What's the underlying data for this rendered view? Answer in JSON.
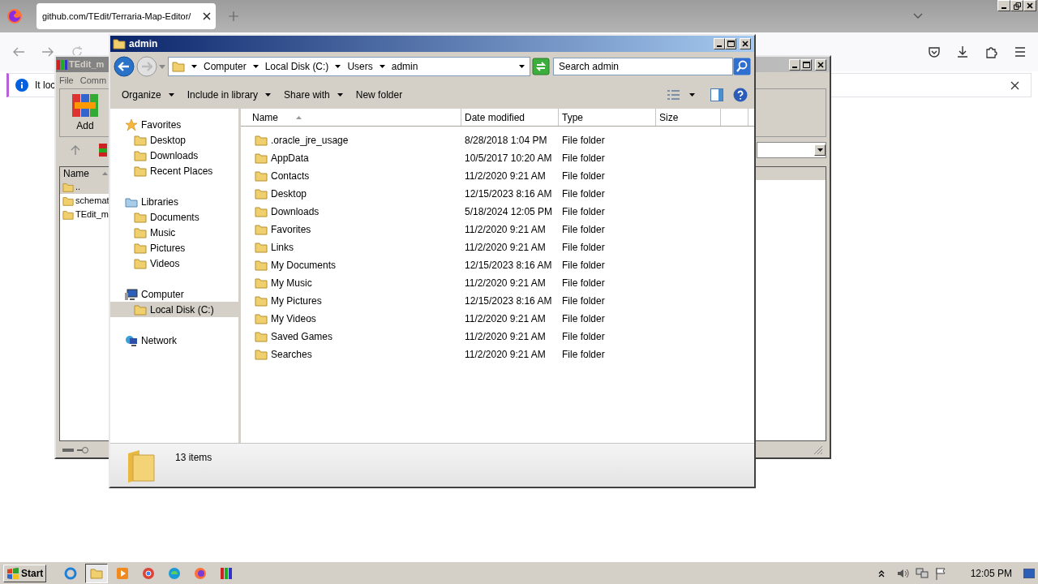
{
  "browser": {
    "tab_title": "github.com/TEdit/Terraria-Map-Editor/",
    "notification": "It loc"
  },
  "winrar": {
    "title": "TEdit_m",
    "menu": [
      "File",
      "Comm"
    ],
    "tool": "Add",
    "column": "Name",
    "rows": [
      "..",
      "schemat",
      "TEdit_m"
    ]
  },
  "explorer": {
    "title": "admin",
    "breadcrumb": [
      "Computer",
      "Local Disk (C:)",
      "Users",
      "admin"
    ],
    "search": {
      "placeholder": "Search admin"
    },
    "toolbar": [
      {
        "label": "Organize",
        "dropdown": true
      },
      {
        "label": "Include in library",
        "dropdown": true
      },
      {
        "label": "Share with",
        "dropdown": true
      },
      {
        "label": "New folder",
        "dropdown": false
      }
    ],
    "nav": [
      {
        "label": "Favorites",
        "selected": false,
        "children": [
          {
            "label": "Desktop",
            "selected": false
          },
          {
            "label": "Downloads",
            "selected": false
          },
          {
            "label": "Recent Places",
            "selected": false
          }
        ]
      },
      {
        "label": "Libraries",
        "selected": false,
        "children": [
          {
            "label": "Documents",
            "selected": false
          },
          {
            "label": "Music",
            "selected": false
          },
          {
            "label": "Pictures",
            "selected": false
          },
          {
            "label": "Videos",
            "selected": false
          }
        ]
      },
      {
        "label": "Computer",
        "selected": false,
        "children": [
          {
            "label": "Local Disk (C:)",
            "selected": true
          }
        ]
      },
      {
        "label": "Network",
        "selected": false
      }
    ],
    "columns": [
      "Name",
      "Date modified",
      "Type",
      "Size"
    ],
    "rows": [
      {
        "name": ".oracle_jre_usage",
        "date": "8/28/2018 1:04 PM",
        "type": "File folder"
      },
      {
        "name": "AppData",
        "date": "10/5/2017 10:20 AM",
        "type": "File folder"
      },
      {
        "name": "Contacts",
        "date": "11/2/2020 9:21 AM",
        "type": "File folder"
      },
      {
        "name": "Desktop",
        "date": "12/15/2023 8:16 AM",
        "type": "File folder"
      },
      {
        "name": "Downloads",
        "date": "5/18/2024 12:05 PM",
        "type": "File folder"
      },
      {
        "name": "Favorites",
        "date": "11/2/2020 9:21 AM",
        "type": "File folder"
      },
      {
        "name": "Links",
        "date": "11/2/2020 9:21 AM",
        "type": "File folder"
      },
      {
        "name": "My Documents",
        "date": "12/15/2023 8:16 AM",
        "type": "File folder"
      },
      {
        "name": "My Music",
        "date": "11/2/2020 9:21 AM",
        "type": "File folder"
      },
      {
        "name": "My Pictures",
        "date": "12/15/2023 8:16 AM",
        "type": "File folder"
      },
      {
        "name": "My Videos",
        "date": "11/2/2020 9:21 AM",
        "type": "File folder"
      },
      {
        "name": "Saved Games",
        "date": "11/2/2020 9:21 AM",
        "type": "File folder"
      },
      {
        "name": "Searches",
        "date": "11/2/2020 9:21 AM",
        "type": "File folder"
      }
    ],
    "status": "13 items"
  },
  "taskbar": {
    "start": "Start",
    "items": [
      {
        "active": false
      },
      {
        "active": true
      },
      {
        "active": false
      },
      {
        "active": false
      },
      {
        "active": false
      },
      {
        "active": false
      },
      {
        "active": false
      }
    ],
    "clock": "12:05 PM"
  }
}
